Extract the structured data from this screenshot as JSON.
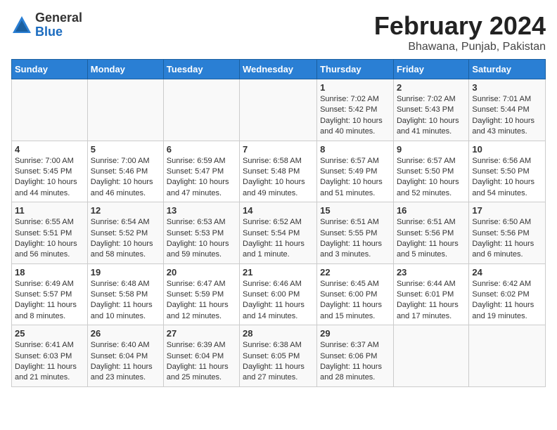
{
  "header": {
    "logo_general": "General",
    "logo_blue": "Blue",
    "month_title": "February 2024",
    "location": "Bhawana, Punjab, Pakistan"
  },
  "days_of_week": [
    "Sunday",
    "Monday",
    "Tuesday",
    "Wednesday",
    "Thursday",
    "Friday",
    "Saturday"
  ],
  "weeks": [
    [
      {
        "day": "",
        "info": ""
      },
      {
        "day": "",
        "info": ""
      },
      {
        "day": "",
        "info": ""
      },
      {
        "day": "",
        "info": ""
      },
      {
        "day": "1",
        "info": "Sunrise: 7:02 AM\nSunset: 5:42 PM\nDaylight: 10 hours\nand 40 minutes."
      },
      {
        "day": "2",
        "info": "Sunrise: 7:02 AM\nSunset: 5:43 PM\nDaylight: 10 hours\nand 41 minutes."
      },
      {
        "day": "3",
        "info": "Sunrise: 7:01 AM\nSunset: 5:44 PM\nDaylight: 10 hours\nand 43 minutes."
      }
    ],
    [
      {
        "day": "4",
        "info": "Sunrise: 7:00 AM\nSunset: 5:45 PM\nDaylight: 10 hours\nand 44 minutes."
      },
      {
        "day": "5",
        "info": "Sunrise: 7:00 AM\nSunset: 5:46 PM\nDaylight: 10 hours\nand 46 minutes."
      },
      {
        "day": "6",
        "info": "Sunrise: 6:59 AM\nSunset: 5:47 PM\nDaylight: 10 hours\nand 47 minutes."
      },
      {
        "day": "7",
        "info": "Sunrise: 6:58 AM\nSunset: 5:48 PM\nDaylight: 10 hours\nand 49 minutes."
      },
      {
        "day": "8",
        "info": "Sunrise: 6:57 AM\nSunset: 5:49 PM\nDaylight: 10 hours\nand 51 minutes."
      },
      {
        "day": "9",
        "info": "Sunrise: 6:57 AM\nSunset: 5:50 PM\nDaylight: 10 hours\nand 52 minutes."
      },
      {
        "day": "10",
        "info": "Sunrise: 6:56 AM\nSunset: 5:50 PM\nDaylight: 10 hours\nand 54 minutes."
      }
    ],
    [
      {
        "day": "11",
        "info": "Sunrise: 6:55 AM\nSunset: 5:51 PM\nDaylight: 10 hours\nand 56 minutes."
      },
      {
        "day": "12",
        "info": "Sunrise: 6:54 AM\nSunset: 5:52 PM\nDaylight: 10 hours\nand 58 minutes."
      },
      {
        "day": "13",
        "info": "Sunrise: 6:53 AM\nSunset: 5:53 PM\nDaylight: 10 hours\nand 59 minutes."
      },
      {
        "day": "14",
        "info": "Sunrise: 6:52 AM\nSunset: 5:54 PM\nDaylight: 11 hours\nand 1 minute."
      },
      {
        "day": "15",
        "info": "Sunrise: 6:51 AM\nSunset: 5:55 PM\nDaylight: 11 hours\nand 3 minutes."
      },
      {
        "day": "16",
        "info": "Sunrise: 6:51 AM\nSunset: 5:56 PM\nDaylight: 11 hours\nand 5 minutes."
      },
      {
        "day": "17",
        "info": "Sunrise: 6:50 AM\nSunset: 5:56 PM\nDaylight: 11 hours\nand 6 minutes."
      }
    ],
    [
      {
        "day": "18",
        "info": "Sunrise: 6:49 AM\nSunset: 5:57 PM\nDaylight: 11 hours\nand 8 minutes."
      },
      {
        "day": "19",
        "info": "Sunrise: 6:48 AM\nSunset: 5:58 PM\nDaylight: 11 hours\nand 10 minutes."
      },
      {
        "day": "20",
        "info": "Sunrise: 6:47 AM\nSunset: 5:59 PM\nDaylight: 11 hours\nand 12 minutes."
      },
      {
        "day": "21",
        "info": "Sunrise: 6:46 AM\nSunset: 6:00 PM\nDaylight: 11 hours\nand 14 minutes."
      },
      {
        "day": "22",
        "info": "Sunrise: 6:45 AM\nSunset: 6:00 PM\nDaylight: 11 hours\nand 15 minutes."
      },
      {
        "day": "23",
        "info": "Sunrise: 6:44 AM\nSunset: 6:01 PM\nDaylight: 11 hours\nand 17 minutes."
      },
      {
        "day": "24",
        "info": "Sunrise: 6:42 AM\nSunset: 6:02 PM\nDaylight: 11 hours\nand 19 minutes."
      }
    ],
    [
      {
        "day": "25",
        "info": "Sunrise: 6:41 AM\nSunset: 6:03 PM\nDaylight: 11 hours\nand 21 minutes."
      },
      {
        "day": "26",
        "info": "Sunrise: 6:40 AM\nSunset: 6:04 PM\nDaylight: 11 hours\nand 23 minutes."
      },
      {
        "day": "27",
        "info": "Sunrise: 6:39 AM\nSunset: 6:04 PM\nDaylight: 11 hours\nand 25 minutes."
      },
      {
        "day": "28",
        "info": "Sunrise: 6:38 AM\nSunset: 6:05 PM\nDaylight: 11 hours\nand 27 minutes."
      },
      {
        "day": "29",
        "info": "Sunrise: 6:37 AM\nSunset: 6:06 PM\nDaylight: 11 hours\nand 28 minutes."
      },
      {
        "day": "",
        "info": ""
      },
      {
        "day": "",
        "info": ""
      }
    ]
  ]
}
